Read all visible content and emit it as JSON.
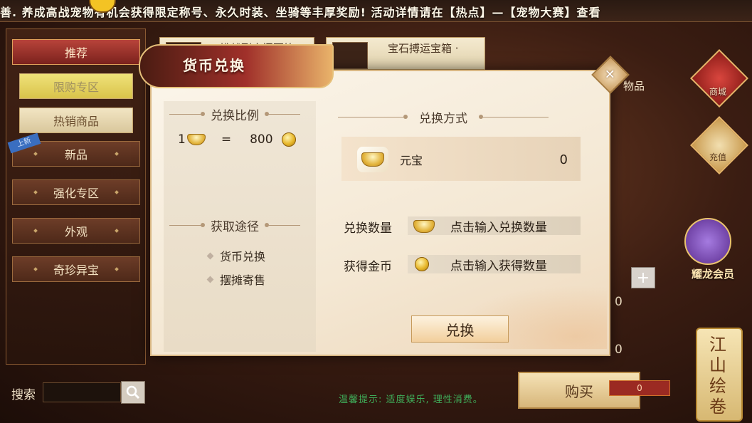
{
  "marquee": {
    "text": "善. 养成高战宠物有机会获得限定称号、永久时装、坐骑等丰厚奖励! 活动详情请在【热点】—【宠物大赛】查看"
  },
  "sidebar": {
    "items": [
      {
        "label": "推荐"
      },
      {
        "label": "限购专区"
      },
      {
        "label": "热销商品"
      },
      {
        "label": "新品",
        "tag": "上新"
      },
      {
        "label": "强化专区"
      },
      {
        "label": "外观"
      },
      {
        "label": "奇珍异宝"
      }
    ]
  },
  "search": {
    "label": "搜索"
  },
  "shop_cards": [
    {
      "label": "挑战副本门票箱"
    },
    {
      "label": "宝石搏运宝箱 ·"
    }
  ],
  "background": {
    "items_label": "物品",
    "qty_value_1": "0",
    "qty_value_2": "0",
    "buy_label": "购买",
    "price_value": "0",
    "tip": "温馨提示: 适度娱乐, 理性消费。"
  },
  "right_icons": {
    "shop": "商城",
    "recharge": "充值",
    "vip": "耀龙会员",
    "scroll": "江山绘卷"
  },
  "dialog": {
    "title": "货币兑换",
    "rate_title": "兑换比例",
    "rate_left": "1",
    "rate_eq": "=",
    "rate_right": "800",
    "ways_title": "获取途径",
    "ways": [
      "货币兑换",
      "摆摊寄售"
    ],
    "method_title": "兑换方式",
    "method_name": "元宝",
    "method_value": "0",
    "qty_label": "兑换数量",
    "qty_placeholder": "点击输入兑换数量",
    "gold_label": "获得金币",
    "gold_placeholder": "点击输入获得数量",
    "exchange_label": "兑换"
  },
  "colors": {
    "accent_red": "#a0302a",
    "gold": "#e3b43c",
    "panel": "#fbf5ea",
    "tip_green": "#3fae5a"
  },
  "icons": [
    "close-icon",
    "search-icon",
    "ingot-icon",
    "gold-coin-icon",
    "plus-icon"
  ]
}
